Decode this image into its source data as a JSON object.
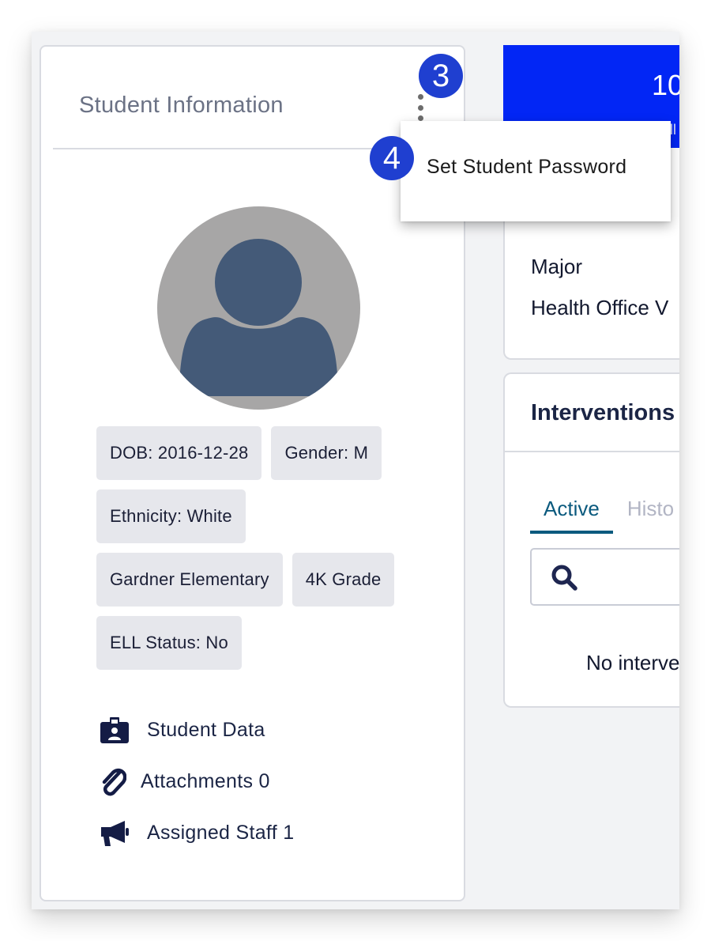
{
  "student_card": {
    "title": "Student Information",
    "menu_icon": "kebab-vertical-icon",
    "avatar_icon": "default-user-avatar",
    "chips": [
      [
        "DOB: 2016-12-28",
        "Gender: M"
      ],
      [
        "Ethnicity: White"
      ],
      [
        "Gardner Elementary",
        "4K Grade"
      ],
      [
        "ELL Status: No"
      ]
    ],
    "links": [
      {
        "icon": "id-badge-icon",
        "label": "Student Data"
      },
      {
        "icon": "paperclip-icon",
        "label": "Attachments 0"
      },
      {
        "icon": "megaphone-icon",
        "label": "Assigned Staff 1"
      }
    ]
  },
  "context_menu": {
    "items": [
      "Set Student Password"
    ]
  },
  "step_badges": {
    "kebab_step": "3",
    "menu_step": "4"
  },
  "banner": {
    "value": "10",
    "sub_icon": "theater-masks-icon",
    "sub_label": "Full",
    "color": "#0226f5"
  },
  "info_card": {
    "lines": [
      "Major",
      "Health Office V"
    ]
  },
  "interventions": {
    "title": "Interventions",
    "tabs": [
      {
        "label": "Active",
        "active": true
      },
      {
        "label": "Histo",
        "active": false
      }
    ],
    "search_placeholder": "",
    "empty_text": "No interve"
  },
  "colors": {
    "accent_tab": "#0b5a7e",
    "step_badge": "#1f3fd0",
    "text_dark": "#1b2545"
  }
}
